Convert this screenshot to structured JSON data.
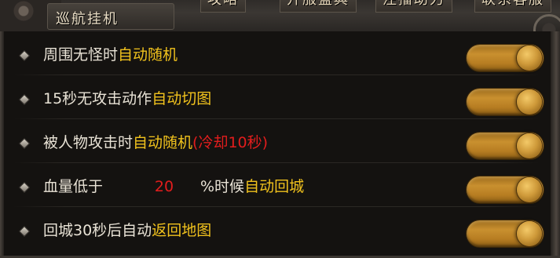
{
  "header": {
    "title": "巡航挂机",
    "tabs": [
      "攻略",
      "开服盛典",
      "注播助力",
      "联系客服"
    ]
  },
  "settings": [
    {
      "id": "auto-random-idle",
      "parts": [
        {
          "text": "周围无怪时",
          "color": "w"
        },
        {
          "text": "自动随机",
          "color": "y"
        }
      ],
      "enabled": true
    },
    {
      "id": "auto-switch-map",
      "parts": [
        {
          "text": "15秒无攻击动作",
          "color": "w"
        },
        {
          "text": "自动切图",
          "color": "y"
        }
      ],
      "enabled": true
    },
    {
      "id": "auto-random-attacked",
      "parts": [
        {
          "text": "被人物攻击时",
          "color": "w"
        },
        {
          "text": "自动随机",
          "color": "y"
        },
        {
          "text": "(冷却10秒)",
          "color": "r"
        }
      ],
      "enabled": true
    },
    {
      "id": "auto-return-city",
      "prefix": "血量低于",
      "value": "20",
      "suffix_parts": [
        {
          "text": "%时候",
          "color": "w"
        },
        {
          "text": "自动回城",
          "color": "y"
        }
      ],
      "enabled": true
    },
    {
      "id": "auto-return-map",
      "parts": [
        {
          "text": "回城30秒后自动",
          "color": "w"
        },
        {
          "text": "返回地图",
          "color": "y"
        }
      ],
      "enabled": true
    }
  ],
  "colors": {
    "white_text": "#e9e3d6",
    "yellow_text": "#f1c21d",
    "red_text": "#e21d1d",
    "toggle_on": "#c9902f"
  },
  "icons": {
    "bullet": "diamond-bullet-icon",
    "toggle": "toggle-switch"
  }
}
